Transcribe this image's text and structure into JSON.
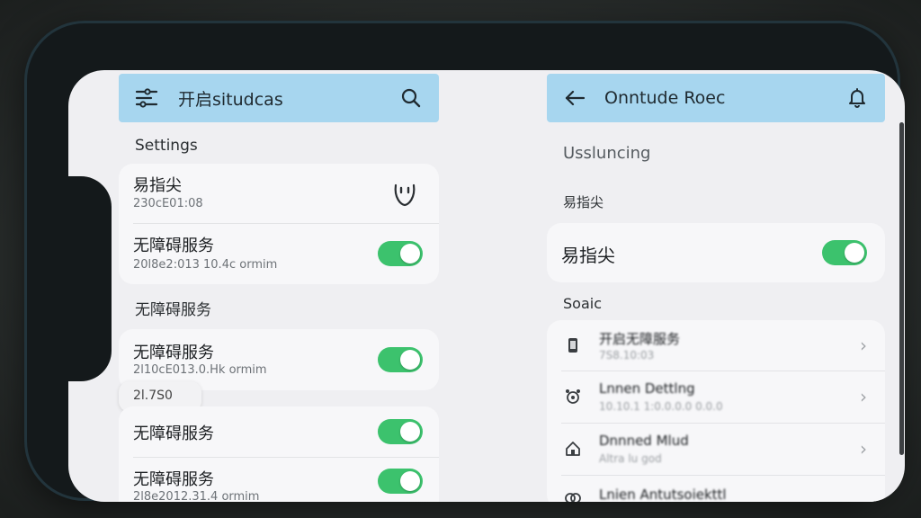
{
  "left_panel": {
    "header": {
      "title": "开启situdcas",
      "menu_icon": "menu-icon",
      "search_icon": "search-icon"
    },
    "section_settings": "Settings",
    "card1": {
      "item1": {
        "title": "易指尖",
        "subtitle": "230cE01:08",
        "icon": "smile-face-icon"
      },
      "item2": {
        "title": "无障碍服务",
        "subtitle": "20l8e2:013 10.4c ormim",
        "toggle_on": true
      }
    },
    "section_accessibility": "无障碍服务",
    "card2": {
      "item1": {
        "title": "无障碍服务",
        "subtitle": "2l10cE013.0.Hk ormim",
        "toggle_on": true
      }
    },
    "tooltip": "2l.7S0",
    "card3": {
      "item1": {
        "title": "无障碍服务",
        "toggle_on": true
      },
      "item2": {
        "title": "无障碍服务",
        "subtitle": "2l8e2012.31.4 ormim",
        "toggle_on": true
      }
    }
  },
  "right_panel": {
    "header": {
      "title": "Onntude Roec",
      "back_icon": "back-arrow-icon",
      "bell_icon": "bell-icon"
    },
    "section_title": "Ussluncing",
    "section_subtitle": "易指尖",
    "main_toggle": {
      "label": "易指尖",
      "toggle_on": true
    },
    "section_label": "Soaic",
    "list": [
      {
        "title": "开启无障服务",
        "subtitle": "7S8.10:03",
        "icon": "phone-icon"
      },
      {
        "title": "Lnnen Dettlng",
        "subtitle": "10.10.1 1:0.0.0.0 0.0.0",
        "icon": "gesture-icon"
      },
      {
        "title": "Dnnned Mlud",
        "subtitle": "Altra lu god",
        "icon": "home-icon"
      },
      {
        "title": "Lnien Antutsoiekttl",
        "subtitle": "",
        "icon": "link-icon"
      }
    ]
  },
  "colors": {
    "header_bg": "#a7d6ef",
    "toggle_on": "#3cc26d",
    "screen_bg": "#efeff2",
    "card_bg": "#f7f7f9"
  }
}
